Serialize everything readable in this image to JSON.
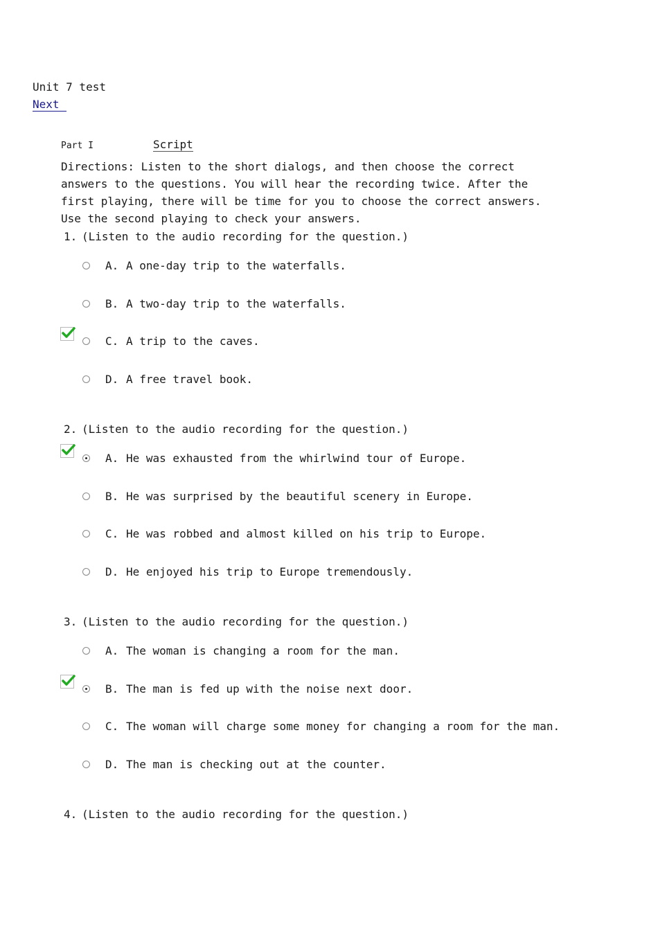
{
  "header": {
    "title": "Unit 7 test",
    "next_label": "Next"
  },
  "part": {
    "label": "Part I",
    "script_label": "Script"
  },
  "directions": "Directions: Listen to the short dialogs, and then choose the correct answers to the questions. You will hear the recording twice. After the first playing, there will be time for you to choose the correct answers. Use the second playing to check your answers.",
  "questions": [
    {
      "number": "1.",
      "prompt": "(Listen to the audio recording for the question.)",
      "options": [
        {
          "letter": "A.",
          "text": "A one-day trip to the waterfalls.",
          "selected": false,
          "correct": false
        },
        {
          "letter": "B.",
          "text": "A two-day trip to the waterfalls.",
          "selected": false,
          "correct": false
        },
        {
          "letter": "C.",
          "text": "A trip to the caves.",
          "selected": false,
          "correct": true
        },
        {
          "letter": "D.",
          "text": "A free travel book.",
          "selected": false,
          "correct": false
        }
      ]
    },
    {
      "number": "2.",
      "prompt": "(Listen to the audio recording for the question.)",
      "options": [
        {
          "letter": "A.",
          "text": "He was exhausted from the whirlwind tour of Europe.",
          "selected": true,
          "correct": true
        },
        {
          "letter": "B.",
          "text": "He was surprised by the beautiful scenery in Europe.",
          "selected": false,
          "correct": false
        },
        {
          "letter": "C.",
          "text": "He was robbed and almost killed on his trip to Europe.",
          "selected": false,
          "correct": false
        },
        {
          "letter": "D.",
          "text": "He enjoyed his trip to Europe tremendously.",
          "selected": false,
          "correct": false
        }
      ]
    },
    {
      "number": "3.",
      "prompt": "(Listen to the audio recording for the question.)",
      "options": [
        {
          "letter": "A.",
          "text": "The woman is changing a room for the man.",
          "selected": false,
          "correct": false
        },
        {
          "letter": "B.",
          "text": "The man is fed up with the noise next door.",
          "selected": true,
          "correct": true
        },
        {
          "letter": "C.",
          "text": "The woman will charge some money for changing a room for the man.",
          "selected": false,
          "correct": false
        },
        {
          "letter": "D.",
          "text": "The man is checking out at the counter.",
          "selected": false,
          "correct": false
        }
      ]
    },
    {
      "number": "4.",
      "prompt": "(Listen to the audio recording for the question.)",
      "options": []
    }
  ],
  "colors": {
    "link": "#1a1a8c",
    "check": "#22aa22",
    "text": "#1a1a1a"
  },
  "icons": {
    "correct": "check-mark-icon",
    "radio": "radio-button-icon"
  }
}
